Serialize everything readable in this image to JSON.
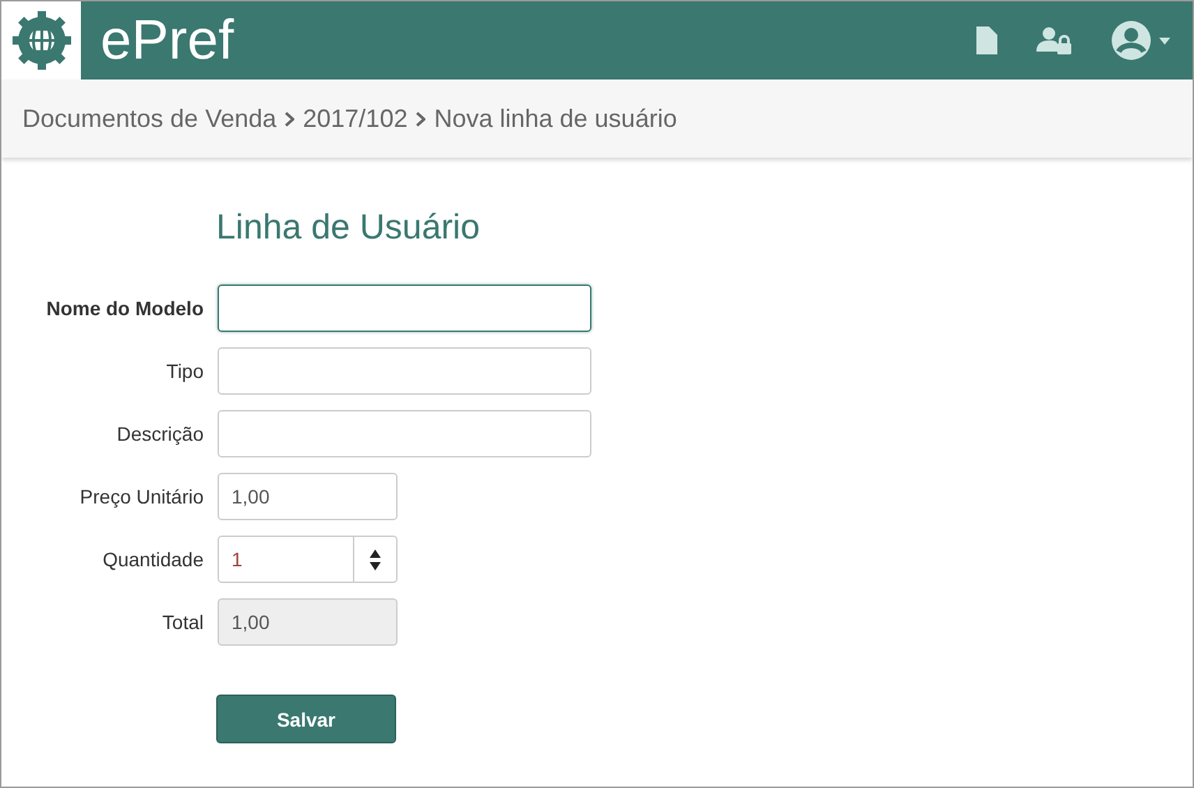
{
  "header": {
    "app_name": "ePref"
  },
  "breadcrumb": [
    "Documentos de Venda",
    "2017/102",
    "Nova linha de usuário"
  ],
  "form": {
    "title": "Linha de Usuário",
    "fields": [
      {
        "label": "Nome do Modelo",
        "kind": "text",
        "wide": true,
        "focused": true
      },
      {
        "label": "Tipo",
        "kind": "text",
        "wide": true,
        "focused": false
      },
      {
        "label": "Descrição",
        "kind": "text",
        "wide": true,
        "focused": false
      },
      {
        "label": "Preço Unitário",
        "kind": "text",
        "wide": false,
        "value": "1,00",
        "focused": false
      },
      {
        "label": "Quantidade",
        "kind": "number",
        "wide": false,
        "value": "1",
        "focused": false
      },
      {
        "label": "Total",
        "kind": "readonly",
        "wide": false,
        "value": "1,00",
        "focused": false
      }
    ],
    "submit": "Salvar"
  }
}
